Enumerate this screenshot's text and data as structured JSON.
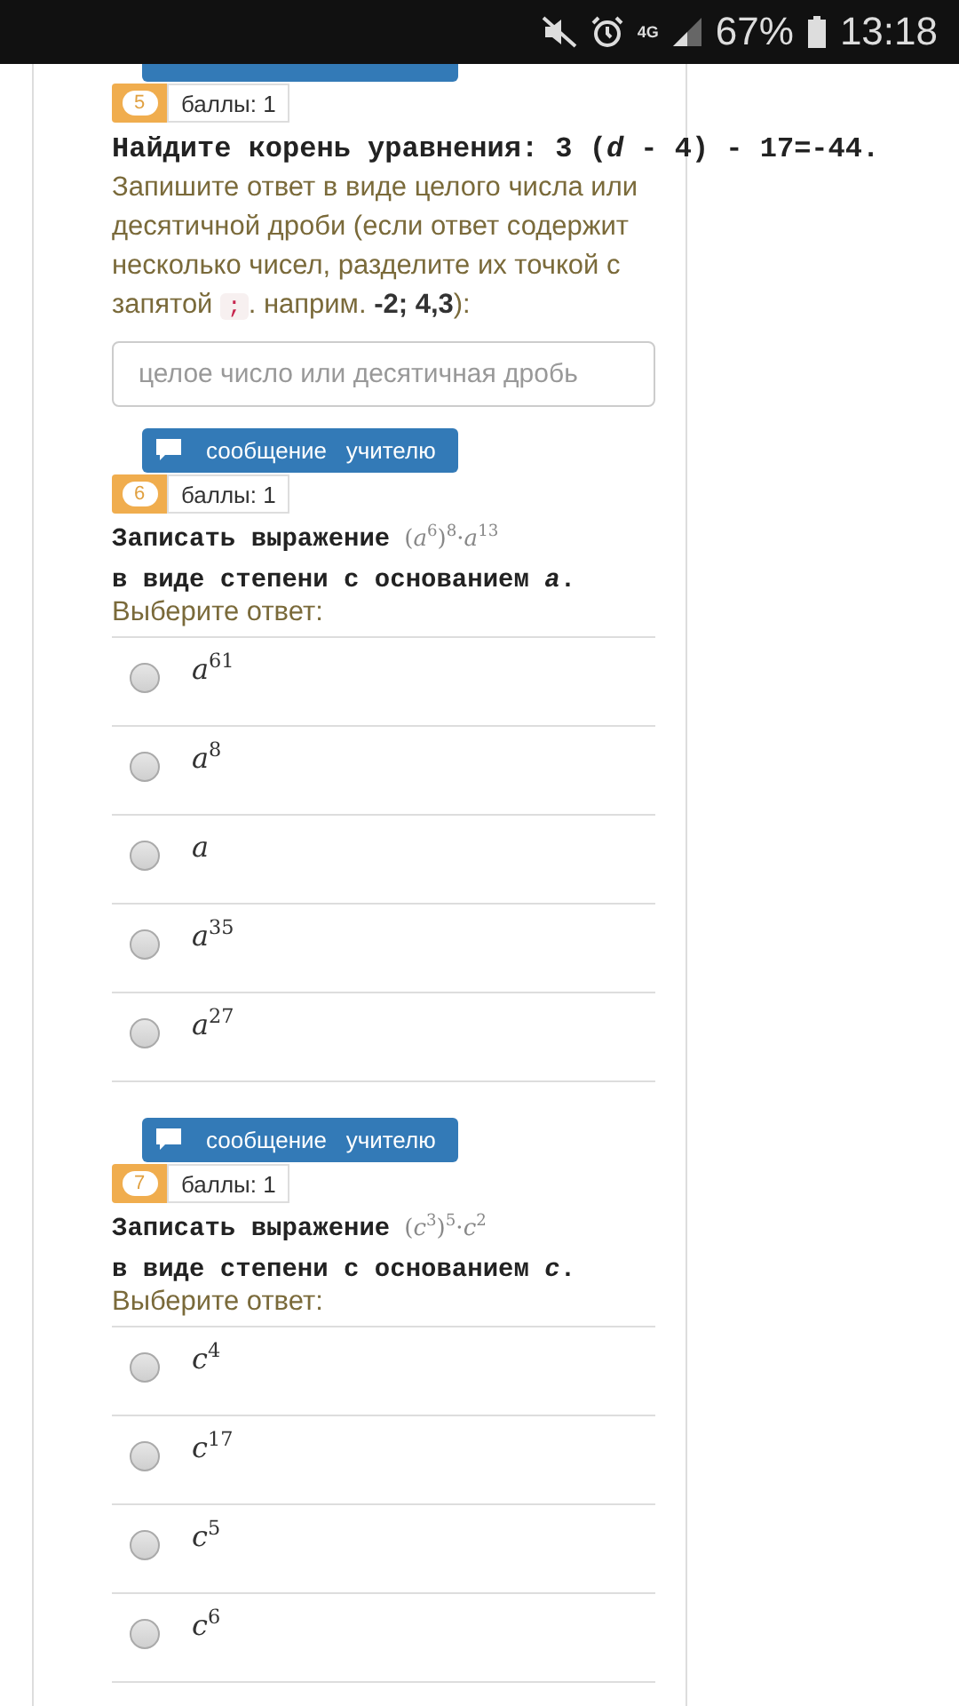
{
  "status_bar": {
    "network": "4G",
    "battery": "67%",
    "time": "13:18"
  },
  "question_5": {
    "number": "5",
    "points": "баллы: 1",
    "prompt": "Найдите корень уравнения: 3 (*d* - 4) - 17=-44.",
    "hint_before": "Запишите ответ в виде целого числа или десятичной дроби (если ответ содержит несколько чисел, разделите их точкой с запятой",
    "separator": ";",
    "hint_after": ". наприм. **-2; 4,3**):",
    "placeholder": "целое число или десятичная дробь"
  },
  "question_6": {
    "message_button": "сообщение   учителю",
    "number": "6",
    "points": "баллы: 1",
    "prompt": "Записать выражение",
    "formula": "(*a*$^{6}$)$^{8}$·*a*$^{13}$",
    "prompt_2": "в виде степени с основанием *a*.",
    "choose": "Выберите ответ:",
    "options": [
      {
        "text": "*a*$^{61}$",
        "selected": false
      },
      {
        "text": "*a*$^{8}$",
        "selected": false
      },
      {
        "text": "*a*",
        "selected": false
      },
      {
        "text": "*a*$^{35}$",
        "selected": false
      },
      {
        "text": "*a*$^{27}$",
        "selected": false
      }
    ]
  },
  "question_7": {
    "message_button": "сообщение   учителю",
    "number": "7",
    "points": "баллы: 1",
    "prompt": "Записать выражение",
    "formula": "(*c*$^{3}$)$^{5}$·*c*$^{2}$",
    "prompt_2": "в виде степени с основанием *c*.",
    "choose": "Выберите ответ:",
    "options": [
      {
        "text": "*c*$^{4}$",
        "selected": false
      },
      {
        "text": "*c*$^{17}$",
        "selected": false
      },
      {
        "text": "*c*$^{5}$",
        "selected": false
      },
      {
        "text": "*c*$^{6}$",
        "selected": false
      }
    ]
  }
}
